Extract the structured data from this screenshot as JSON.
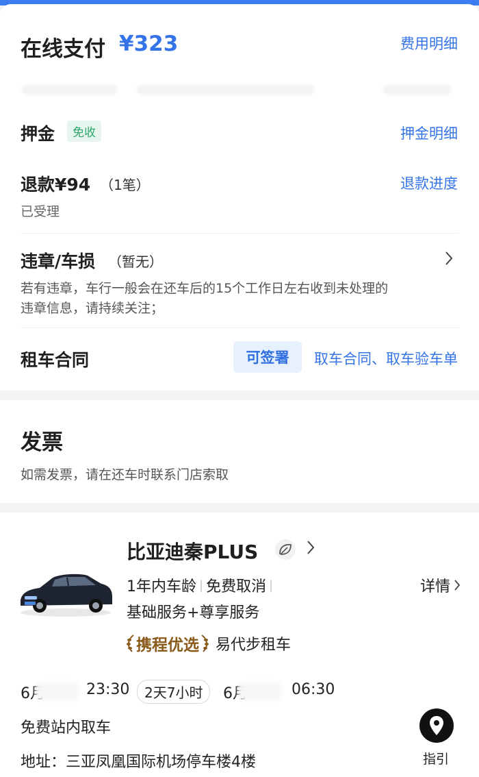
{
  "payment": {
    "title": "在线支付",
    "amount": "¥323",
    "detail_link": "费用明细"
  },
  "deposit": {
    "title": "押金",
    "badge": "免收",
    "detail_link": "押金明细"
  },
  "refund": {
    "title": "退款¥94",
    "count": "（1笔）",
    "status": "已受理",
    "progress_link": "退款进度"
  },
  "violation": {
    "title": "违章/车损",
    "status": "（暂无）",
    "note_line1": "若有违章，车行一般会在还车后的15个工作日左右收到未处理的",
    "note_line2": "违章信息，请持续关注；"
  },
  "contract": {
    "title": "租车合同",
    "sign_button": "可签署",
    "links": "取车合同、取车验车单"
  },
  "invoice": {
    "title": "发票",
    "note": "如需发票，请在还车时联系门店索取"
  },
  "car": {
    "name": "比亚迪秦PLUS",
    "tag1": "1年内车龄",
    "tag2": "免费取消",
    "services": "基础服务+尊享服务",
    "brand": "携程优选",
    "vendor": "易代步租车",
    "detail_link": "详情"
  },
  "trip": {
    "pickup_month": "6月",
    "pickup_time": "23:30",
    "duration": "2天7小时",
    "return_month": "6月",
    "return_time": "06:30",
    "pickup_method": "免费站内取车",
    "address": "地址：三亚凤凰国际机场停车楼4楼",
    "guide_label": "指引"
  },
  "colors": {
    "accent": "#3574e8",
    "green_badge": "#2ea66b",
    "brand_gold": "#8a5a1a"
  },
  "icons": [
    "chevron-right-icon",
    "leaf-icon",
    "laurel-icon",
    "location-pin-icon"
  ]
}
